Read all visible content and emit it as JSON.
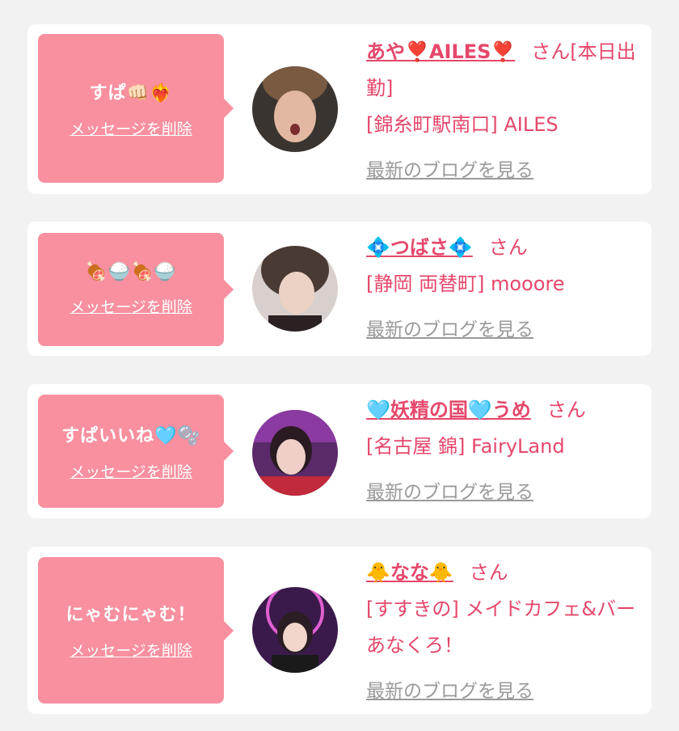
{
  "cards": [
    {
      "message": "すぱ👊🏻❤️‍🔥",
      "delete_label": "メッセージを削除",
      "name": "あや❣️AILES❣️",
      "san": "さん",
      "status": "[本日出勤]",
      "shop": "[錦糸町駅南口] AILES",
      "blog_label": "最新のブログを見る"
    },
    {
      "message": "🍖🍚🍖🍚",
      "delete_label": "メッセージを削除",
      "name": "💠つばさ💠",
      "san": "さん",
      "shop": "[静岡 両替町] mooore",
      "blog_label": "最新のブログを見る"
    },
    {
      "message": "すぱいいね🩵🫧",
      "delete_label": "メッセージを削除",
      "name": "🩵妖精の国🩵うめ",
      "san": "さん",
      "shop": "[名古屋 錦] FairyLand",
      "blog_label": "最新のブログを見る"
    },
    {
      "message": "にゃむにゃむ！",
      "delete_label": "メッセージを削除",
      "name": "🐥なな🐥",
      "san": "さん",
      "shop": "[すすきの] メイドカフェ&バー あなくろ！",
      "blog_label": "最新のブログを見る"
    }
  ],
  "colors": {
    "background": "#f2f2f2",
    "card": "#ffffff",
    "bubble": "#f8909f",
    "accent_text": "#e5476b",
    "link_gray": "#9a9a9a"
  }
}
